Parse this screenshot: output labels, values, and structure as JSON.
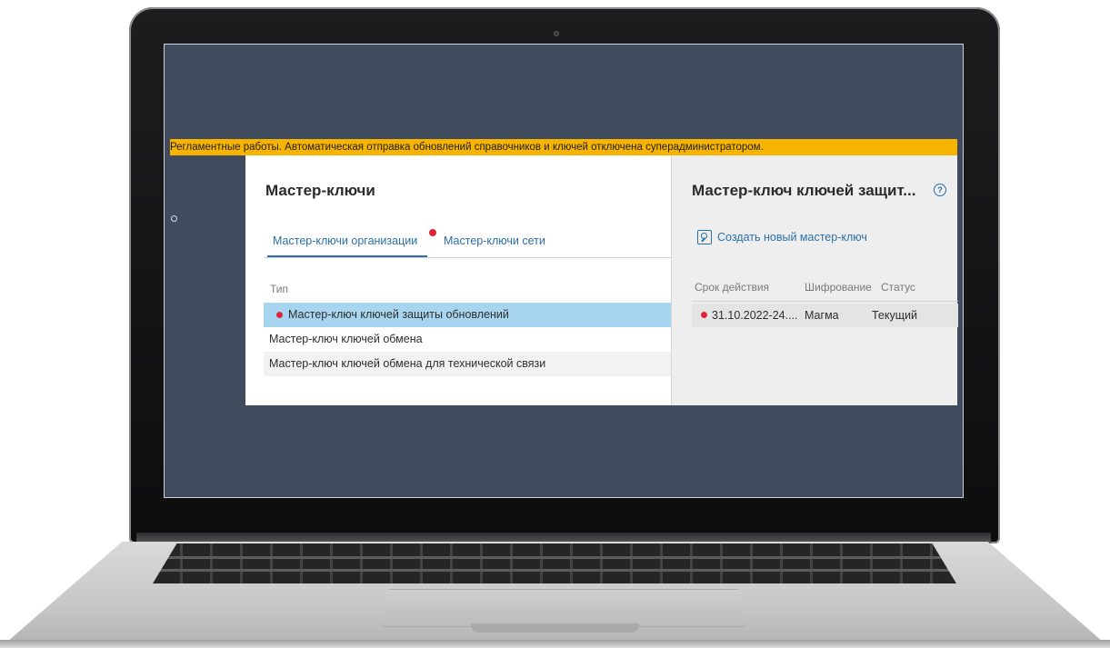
{
  "banner": {
    "text": "Регламентные работы. Автоматическая отправка обновлений справочников и ключей отключена суперадминистратором."
  },
  "left_panel": {
    "title": "Мастер-ключи",
    "tabs": [
      {
        "label": "Мастер-ключи организации",
        "active": true,
        "alert": true
      },
      {
        "label": "Мастер-ключи сети",
        "active": false,
        "alert": false
      }
    ],
    "column_header": "Тип",
    "rows": [
      {
        "label": "Мастер-ключ ключей защиты обновлений",
        "selected": true,
        "alert": true
      },
      {
        "label": "Мастер-ключ ключей обмена",
        "selected": false,
        "alert": false
      },
      {
        "label": "Мастер-ключ ключей обмена для технической связи",
        "selected": false,
        "alert": false
      }
    ]
  },
  "right_panel": {
    "title": "Мастер-ключ ключей защит...",
    "help_icon": "question-circle-icon",
    "create_button": {
      "label": "Создать новый мастер-ключ",
      "icon": "key-icon"
    },
    "columns": [
      "Срок действия",
      "Шифрование",
      "Статус"
    ],
    "rows": [
      {
        "validity": "31.10.2022-24....",
        "encryption": "Магма",
        "status": "Текущий",
        "alert": true
      }
    ]
  },
  "colors": {
    "banner": "#f6b300",
    "screen_bg": "#414b5e",
    "accent": "#2a6fa8",
    "selected_row": "#a7d5ef",
    "alert_dot": "#e0253a"
  }
}
